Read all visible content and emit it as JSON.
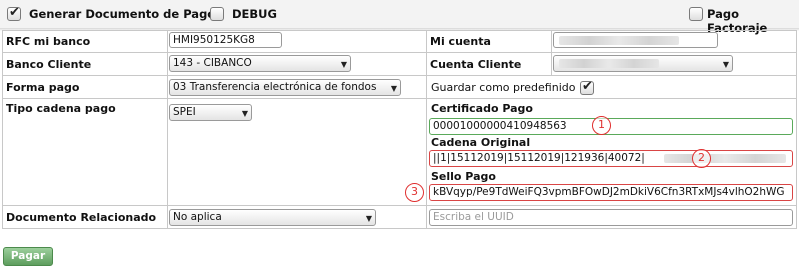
{
  "toolbar": {
    "generar_label": "Generar Documento de Pago",
    "generar_checked": true,
    "debug_label": "DEBUG",
    "debug_checked": false,
    "factoraje_label": "Pago Factoraje",
    "factoraje_checked": false
  },
  "form": {
    "rfc_label": "RFC mi banco",
    "rfc_value": "HMI950125KG8",
    "banco_label": "Banco Cliente",
    "banco_value": "143 - CIBANCO",
    "forma_label": "Forma pago",
    "forma_value": "03 Transferencia electrónica de fondos",
    "tipo_label": "Tipo cadena pago",
    "tipo_value": "SPEI",
    "doc_rel_label": "Documento Relacionado",
    "doc_rel_value": "No aplica",
    "cuenta_label": "Mi cuenta",
    "cuenta_cliente_label": "Cuenta Cliente",
    "guardar_label": "Guardar como predefinido",
    "guardar_checked": true,
    "certificado_label": "Certificado Pago",
    "certificado_value": "00001000000410948563",
    "cadena_label": "Cadena Original",
    "cadena_value": "||1|15112019|15112019|121936|40072|",
    "sello_label": "Sello Pago",
    "sello_value": "kBVqyp/Pe9TdWeiFQ3vpmBFOwDJ2mDkiV6Cfn3RTxMJs4vlhO2hWG",
    "uuid_placeholder": "Escriba el UUID"
  },
  "annotations": [
    "1",
    "2",
    "3"
  ],
  "actions": {
    "pagar_label": "Pagar"
  },
  "colors": {
    "accent_green": "#5e9e5e",
    "annotation_red": "#e03030"
  }
}
